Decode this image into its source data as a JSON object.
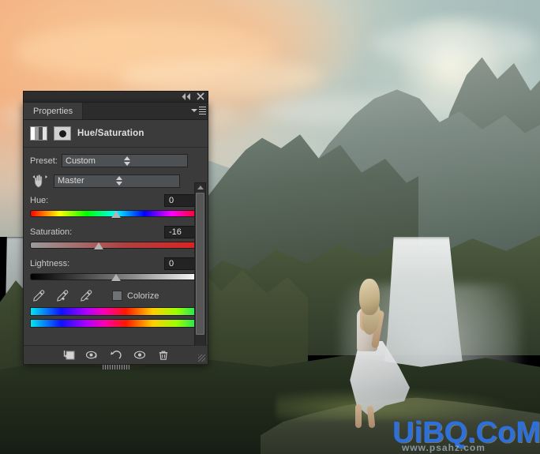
{
  "app": {
    "panel_tab": "Properties",
    "title": "Hue/Saturation",
    "icons": {
      "collapse": "collapse-arrows-icon",
      "close": "close-icon",
      "menu": "panel-menu-icon",
      "adjustment_thumb": "hue-saturation-adjustment-thumbnail",
      "mask_thumb": "layer-mask-thumbnail",
      "on_image_adjust": "on-image-adjustment-hand-icon"
    }
  },
  "preset": {
    "label": "Preset:",
    "value": "Custom"
  },
  "channel": {
    "value": "Master"
  },
  "sliders": [
    {
      "label": "Hue:",
      "value": "0",
      "thumb_pct": 50,
      "track": "hue"
    },
    {
      "label": "Saturation:",
      "value": "-16",
      "thumb_pct": 40,
      "track": "sat"
    },
    {
      "label": "Lightness:",
      "value": "0",
      "thumb_pct": 50,
      "track": "lgt"
    }
  ],
  "colorize": {
    "label": "Colorize",
    "checked": false
  },
  "eyedroppers": [
    {
      "name": "eyedropper-sample-icon"
    },
    {
      "name": "eyedropper-add-icon"
    },
    {
      "name": "eyedropper-subtract-icon"
    }
  ],
  "footer_buttons": [
    {
      "name": "clip-to-layer-button"
    },
    {
      "name": "toggle-previous-state-button"
    },
    {
      "name": "reset-button"
    },
    {
      "name": "toggle-layer-visibility-button"
    },
    {
      "name": "delete-adjustment-layer-button"
    }
  ],
  "scrollbar": {
    "up": "scroll-up-arrow",
    "down": "scroll-down-arrow"
  },
  "watermark": {
    "main": "UiBQ.CoM",
    "sub": "www.psahz.com"
  },
  "colors": {
    "panel_bg": "#3b3b3b",
    "panel_border": "#1e1e1e",
    "field_bg": "#4e5153",
    "numbox_bg": "#232323",
    "text": "#cacaca",
    "watermark_blue": "#2f6fd8"
  }
}
